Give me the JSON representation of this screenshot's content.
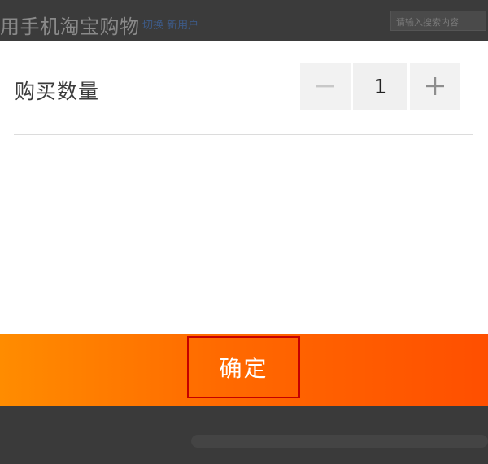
{
  "background": {
    "title": "用手机淘宝购物",
    "links": "切换 新用户",
    "search_placeholder": "请输入搜索内容"
  },
  "quantity": {
    "label": "购买数量",
    "value": "1",
    "decrement_icon": "minus-icon",
    "increment_icon": "plus-icon"
  },
  "confirm": {
    "label": "确定"
  },
  "colors": {
    "accent_start": "#ff8c00",
    "accent_end": "#ff4f00",
    "highlight_border": "#c40000"
  }
}
